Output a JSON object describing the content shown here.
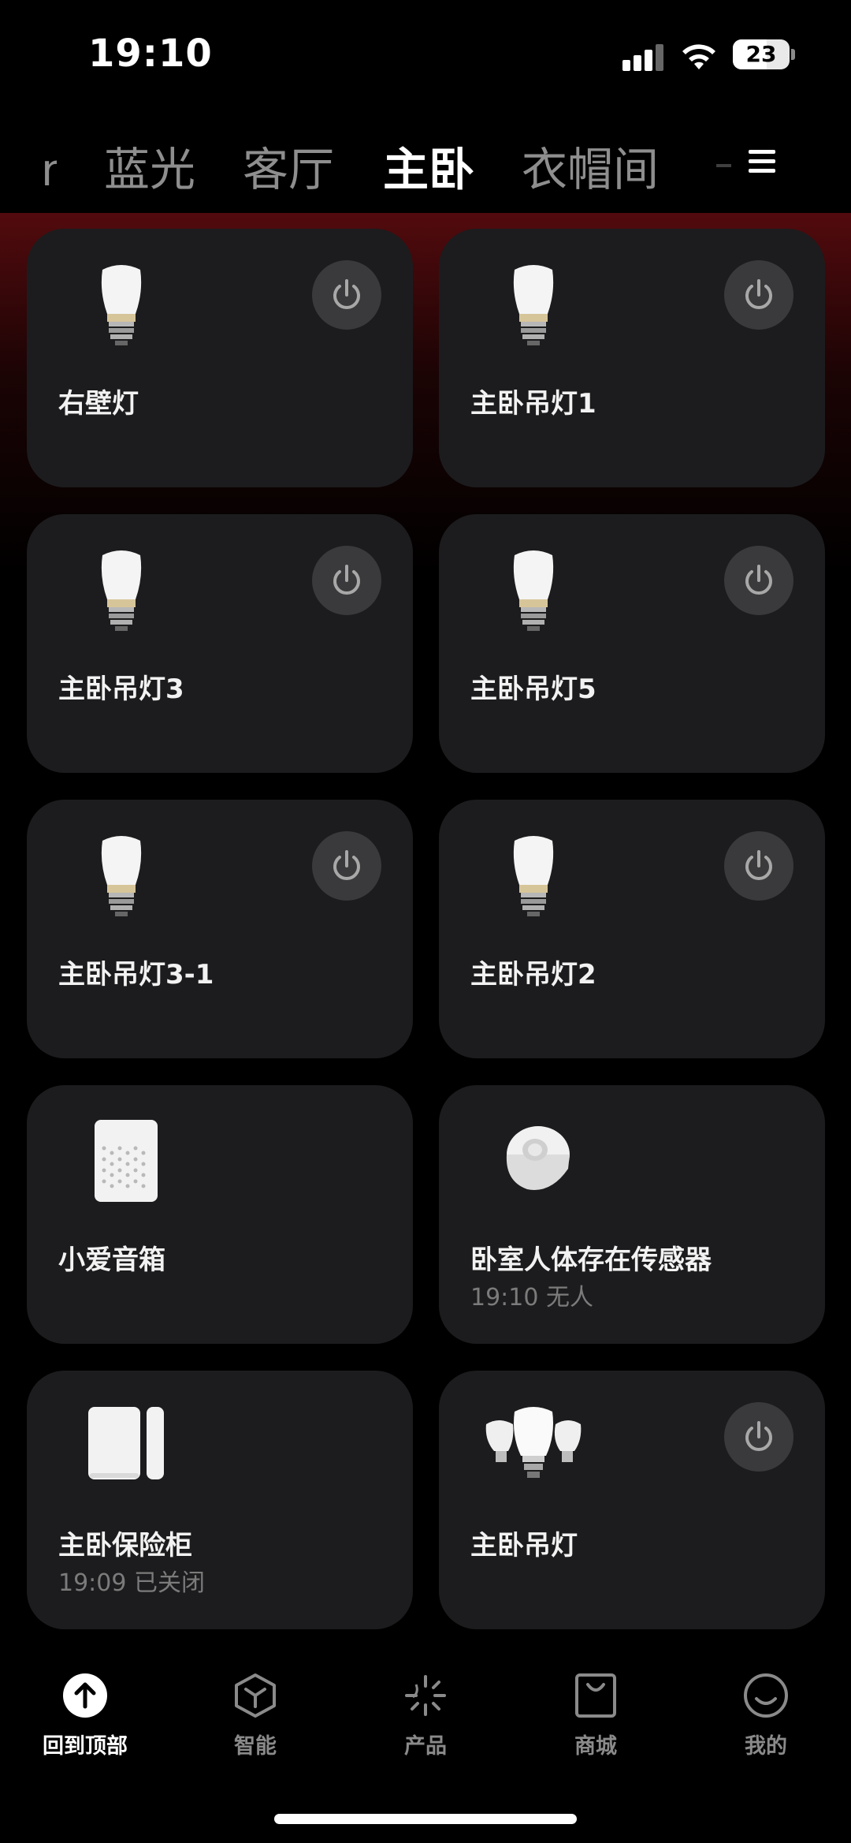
{
  "status_bar": {
    "time": "19:10",
    "battery": "23"
  },
  "rooms": {
    "left_partial": "ni",
    "tabs": [
      "蓝光",
      "客厅",
      "主卧",
      "衣帽间"
    ],
    "active": "主卧",
    "right_partial": "二"
  },
  "devices": [
    {
      "name": "右壁灯",
      "status": "",
      "icon": "bulb-icon",
      "has_power": true
    },
    {
      "name": "主卧吊灯1",
      "status": "",
      "icon": "bulb-icon",
      "has_power": true
    },
    {
      "name": "主卧吊灯3",
      "status": "",
      "icon": "bulb-icon",
      "has_power": true
    },
    {
      "name": "主卧吊灯5",
      "status": "",
      "icon": "bulb-icon",
      "has_power": true
    },
    {
      "name": "主卧吊灯3-1",
      "status": "",
      "icon": "bulb-icon",
      "has_power": true
    },
    {
      "name": "主卧吊灯2",
      "status": "",
      "icon": "bulb-icon",
      "has_power": true
    },
    {
      "name": "小爱音箱",
      "status": "",
      "icon": "speaker-icon",
      "has_power": false
    },
    {
      "name": "卧室人体存在传感器",
      "status": "19:10 无人",
      "icon": "presence-sensor-icon",
      "has_power": false
    },
    {
      "name": "主卧保险柜",
      "status": "19:09 已关闭",
      "icon": "door-sensor-icon",
      "has_power": false
    },
    {
      "name": "主卧吊灯",
      "status": "",
      "icon": "bulb-group-icon",
      "has_power": true
    }
  ],
  "nav": [
    {
      "label": "回到顶部",
      "icon": "arrow-up-icon",
      "active": true
    },
    {
      "label": "智能",
      "icon": "cube-icon",
      "active": false
    },
    {
      "label": "产品",
      "icon": "sparkle-icon",
      "active": false
    },
    {
      "label": "商城",
      "icon": "shopping-bag-icon",
      "active": false
    },
    {
      "label": "我的",
      "icon": "smile-icon",
      "active": false
    }
  ],
  "colors": {
    "background": "#000000",
    "card": "#1c1c1e",
    "power_button": "#3a3a3c",
    "accent_glow": "#6e0e12"
  }
}
